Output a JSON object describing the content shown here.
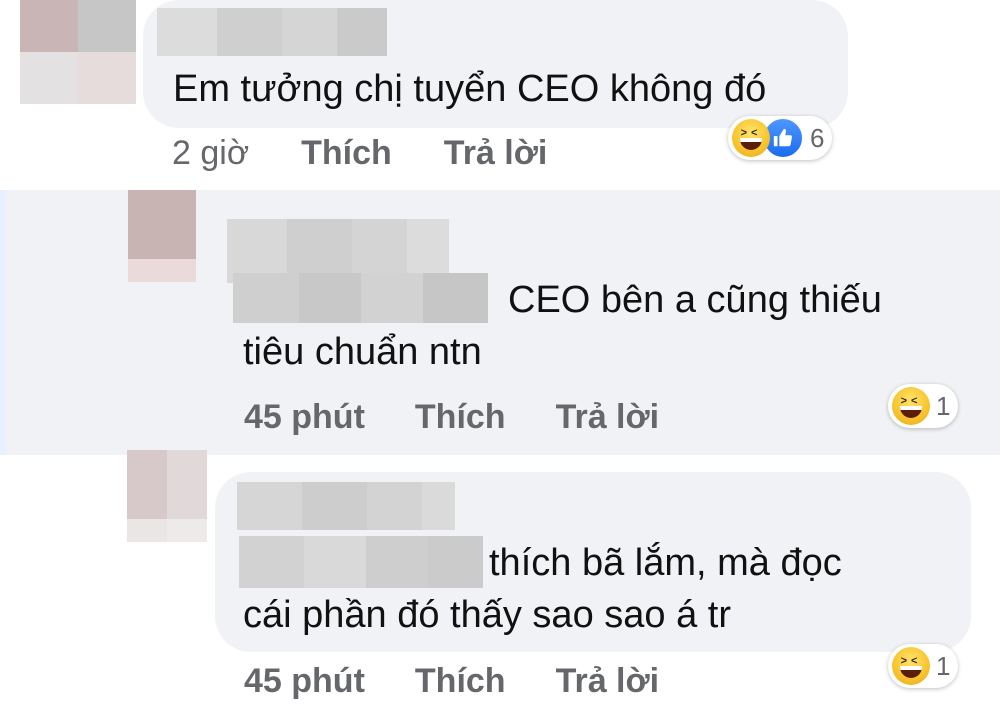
{
  "comments": [
    {
      "text_lines": [
        "Em tưởng chị tuyển CEO không đó"
      ],
      "time": "2 giờ",
      "like_label": "Thích",
      "reply_label": "Trả lời",
      "reactions": {
        "icons": [
          "haha-icon",
          "like-icon"
        ],
        "count": "6"
      }
    },
    {
      "text_lines": [
        "CEO bên a cũng thiếu",
        "tiêu chuẩn ntn"
      ],
      "time": "45 phút",
      "like_label": "Thích",
      "reply_label": "Trả lời",
      "reactions": {
        "icons": [
          "haha-icon"
        ],
        "count": "1"
      }
    },
    {
      "text_lines": [
        "thích bã lắm, mà đọc",
        "cái phần đó thấy sao sao á tr"
      ],
      "time": "45 phút",
      "like_label": "Thích",
      "reply_label": "Trả lời",
      "reactions": {
        "icons": [
          "haha-icon"
        ],
        "count": "1"
      }
    }
  ],
  "colors": {
    "bubble": "#f0f2f5",
    "meta_text": "#65676b",
    "highlight": "#f0f2f5",
    "like_blue": "#1a6cf0"
  }
}
